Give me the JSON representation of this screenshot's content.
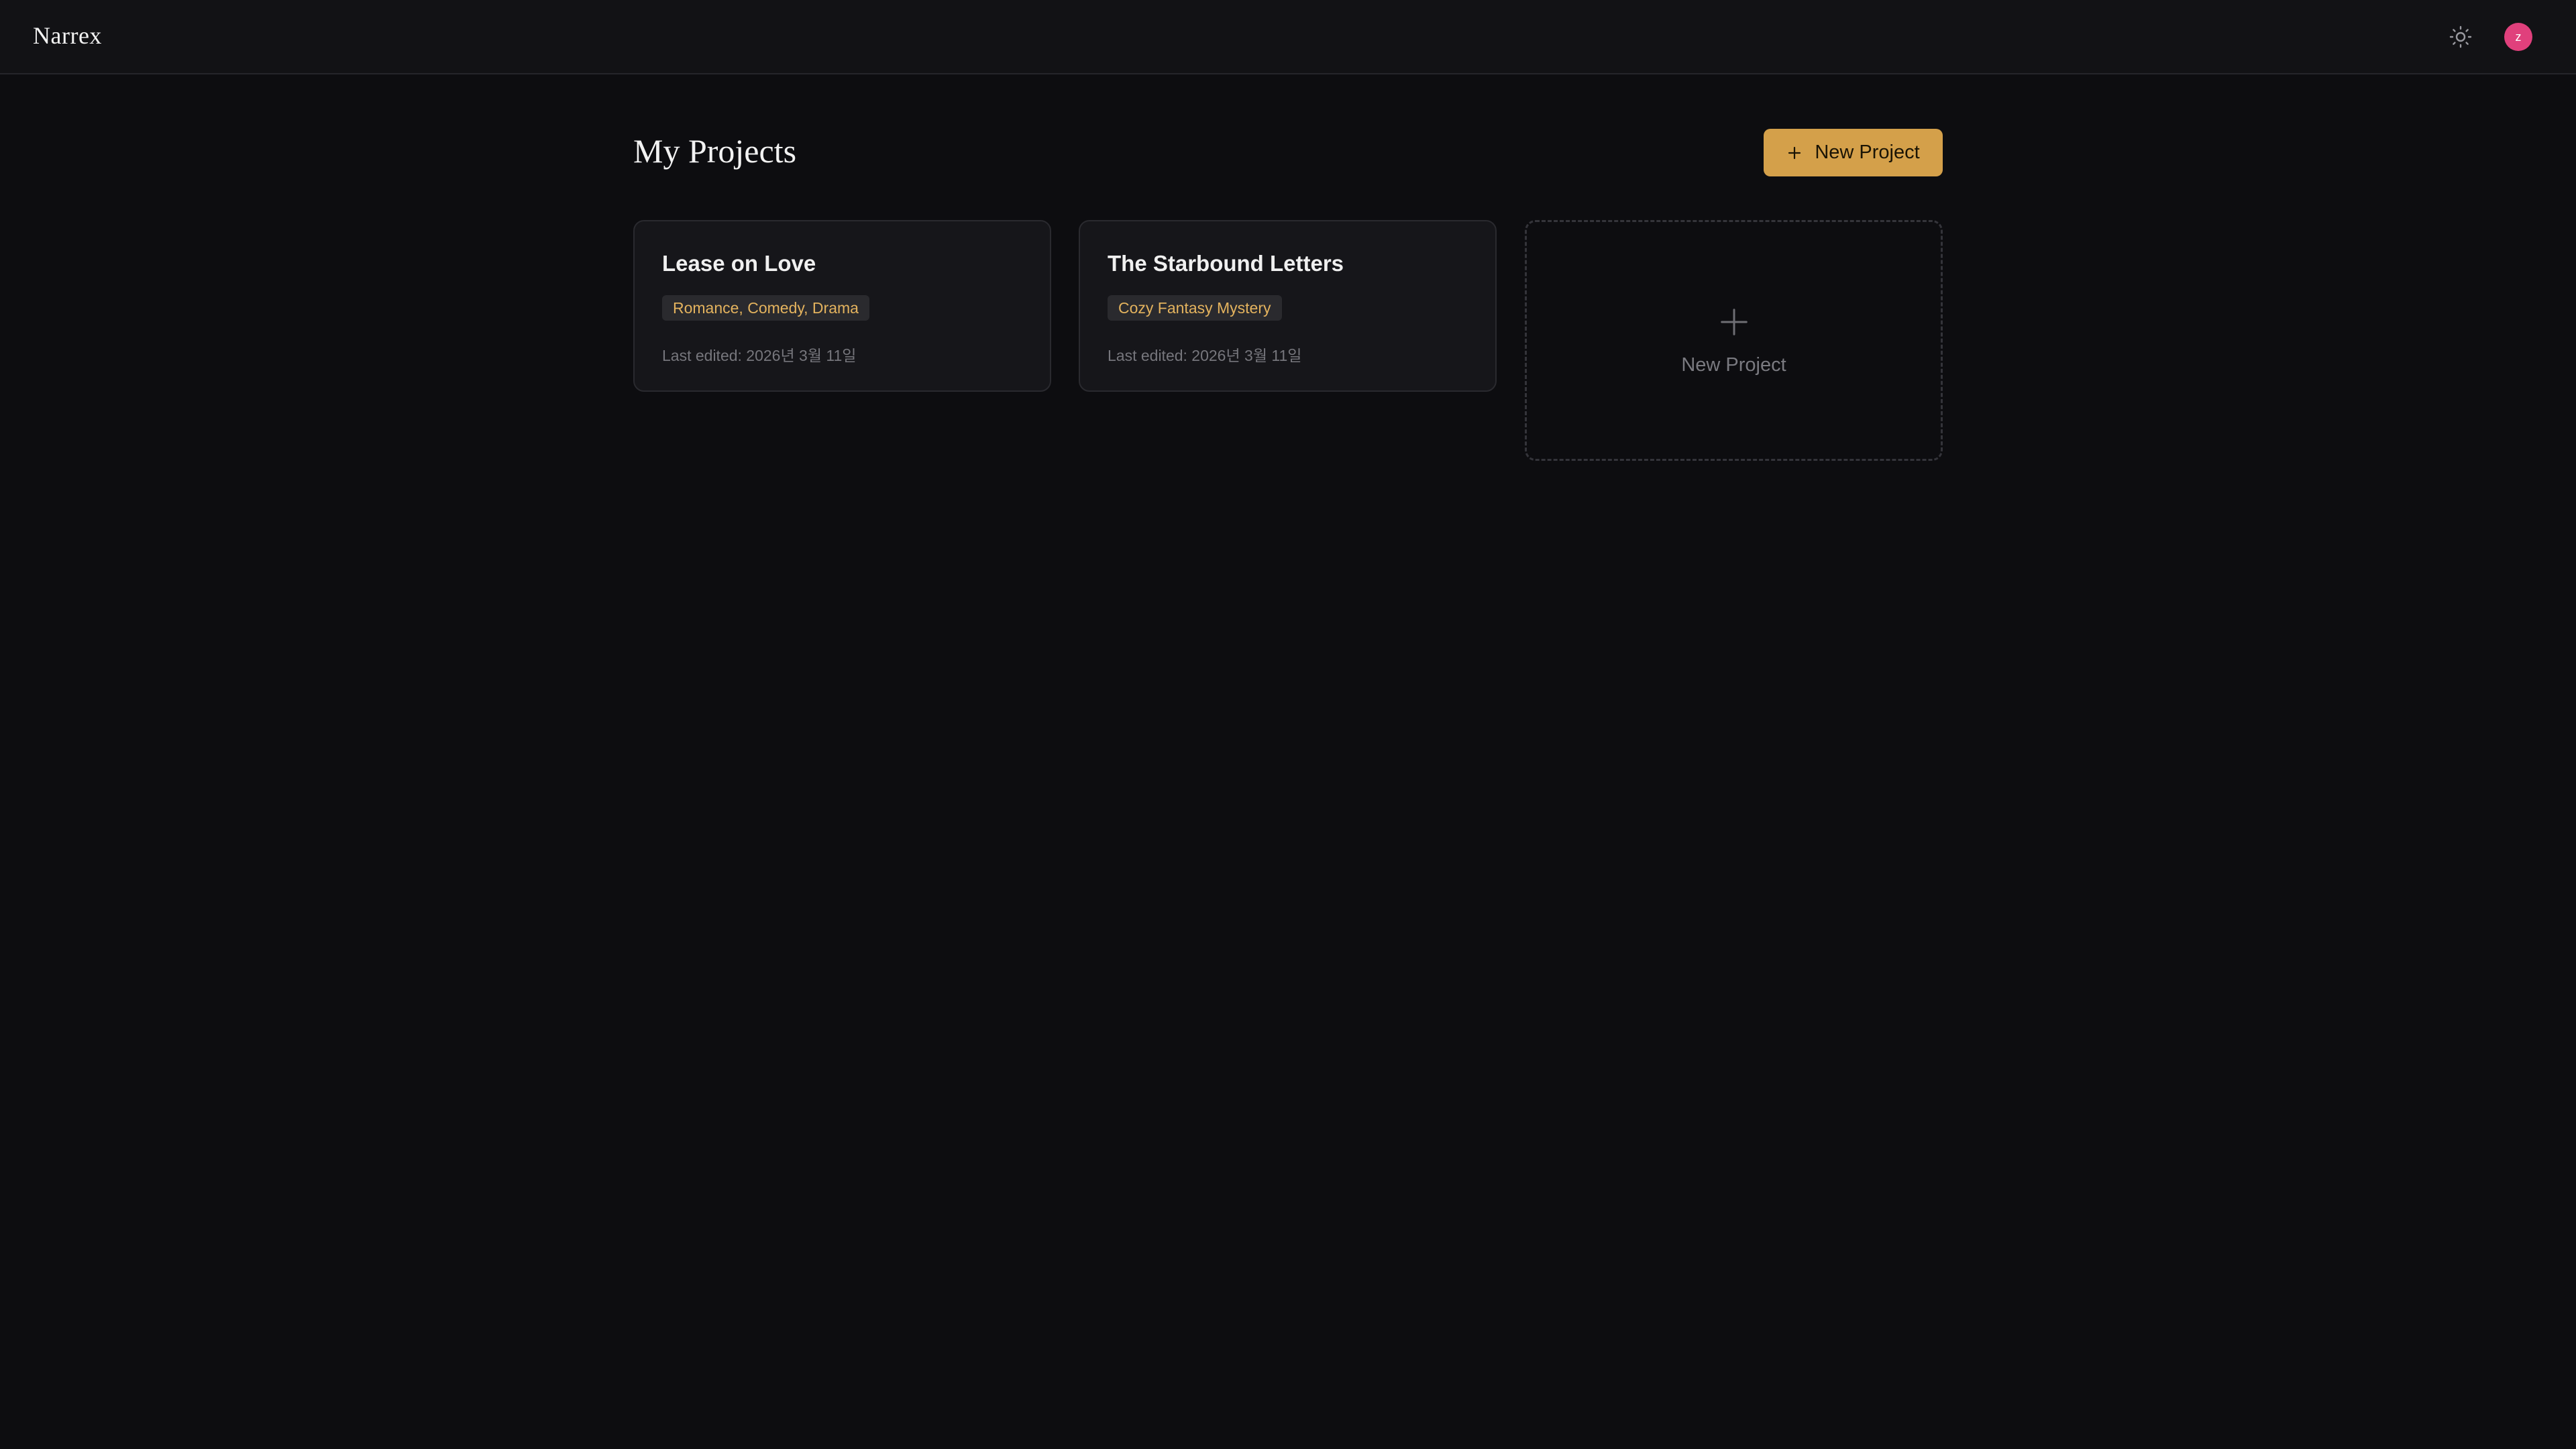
{
  "header": {
    "brand": "Narrex",
    "theme_icon": "sun-icon",
    "avatar_initial": "z",
    "avatar_color": "#e0407c"
  },
  "main": {
    "title": "My Projects",
    "new_project_button": {
      "label": "New Project",
      "icon": "plus-icon",
      "bg_color": "#d4a04a"
    },
    "projects": [
      {
        "title": "Lease on Love",
        "genre": "Romance, Comedy, Drama",
        "last_edited": "Last edited: 2026년 3월 11일"
      },
      {
        "title": "The Starbound Letters",
        "genre": "Cozy Fantasy Mystery",
        "last_edited": "Last edited: 2026년 3월 11일"
      }
    ],
    "new_project_card": {
      "label": "New Project",
      "icon": "plus-icon"
    }
  },
  "colors": {
    "background": "#0d0d10",
    "accent": "#d4a04a",
    "tag_text": "#e4b35e"
  }
}
